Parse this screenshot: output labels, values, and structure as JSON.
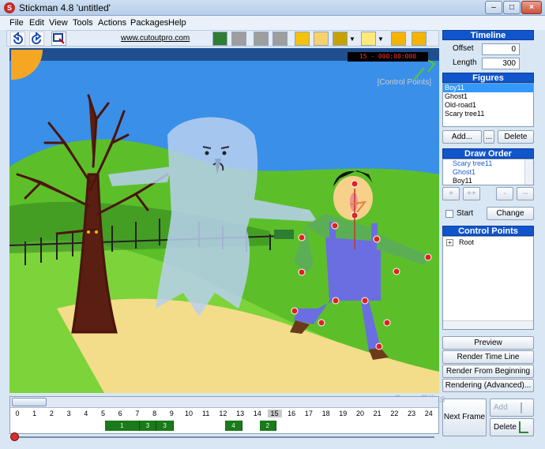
{
  "window": {
    "title": "Stickman 4.8 'untitled'",
    "minimize": "–",
    "maximize": "□",
    "close": "×"
  },
  "menu": [
    "File",
    "Edit",
    "View",
    "Tools",
    "Actions",
    "Packages",
    "Help"
  ],
  "toolbar": {
    "link": "www.cutoutpro.com",
    "icons": [
      "undo-icon",
      "redo-icon",
      "select-icon",
      "image-icon",
      "frame-icon",
      "frame-icon",
      "frame-icon",
      "sun-icon",
      "paper-icon",
      "figure-icon",
      "bulb-icon",
      "camera-icon",
      "camera-record-icon"
    ]
  },
  "stage": {
    "timecode": "15 - 000:00:000",
    "hint": "[Control Points]"
  },
  "timeline_panel": {
    "header": "Timeline",
    "offset_label": "Offset",
    "offset_value": "0",
    "length_label": "Length",
    "length_value": "300"
  },
  "figures_panel": {
    "header": "Figures",
    "items": [
      "Boy11",
      "Ghost1",
      "Old-road1",
      "Scary tree11"
    ],
    "selected_index": 0,
    "add": "Add...",
    "more": "...",
    "delete": "Delete"
  },
  "draw_order_panel": {
    "header": "Draw Order",
    "items": [
      "Scary tree11",
      "Ghost1",
      "Boy11"
    ],
    "btn_plus": "+",
    "btn_plusplus": "++",
    "btn_minus": "-",
    "btn_minusminus": "--",
    "start_label": "Start",
    "change": "Change"
  },
  "control_points_panel": {
    "header": "Control Points",
    "root": "Root",
    "expander": "+"
  },
  "actions": {
    "preview": "Preview",
    "render_timeline": "Render Time Line",
    "render_from_beginning": "Render From Beginning",
    "rendering_advanced": "Rendering (Advanced)...",
    "next_frame": "Next Frame",
    "add": "Add",
    "delete": "Delete"
  },
  "watermark": "SnapFiles",
  "frame_numbers": [
    "0",
    "1",
    "2",
    "3",
    "4",
    "5",
    "6",
    "7",
    "8",
    "9",
    "10",
    "11",
    "12",
    "13",
    "14",
    "15",
    "16",
    "17",
    "18",
    "19",
    "20",
    "21",
    "22",
    "23",
    "24"
  ],
  "current_frame": "15",
  "keyframes": [
    {
      "label": "1",
      "frames": "6-8"
    },
    {
      "label": "3",
      "frames": "8-9"
    },
    {
      "label": "3",
      "frames": "9-10"
    },
    {
      "label": "4",
      "frames": "13-14"
    },
    {
      "label": "2",
      "frames": "15-16"
    }
  ],
  "colors": {
    "sky": "#3a8fe8",
    "grass": "#5cbf2a",
    "path": "#f3dd8a",
    "panel_header": "#1155cc",
    "keyframe": "#1b7a1b"
  }
}
